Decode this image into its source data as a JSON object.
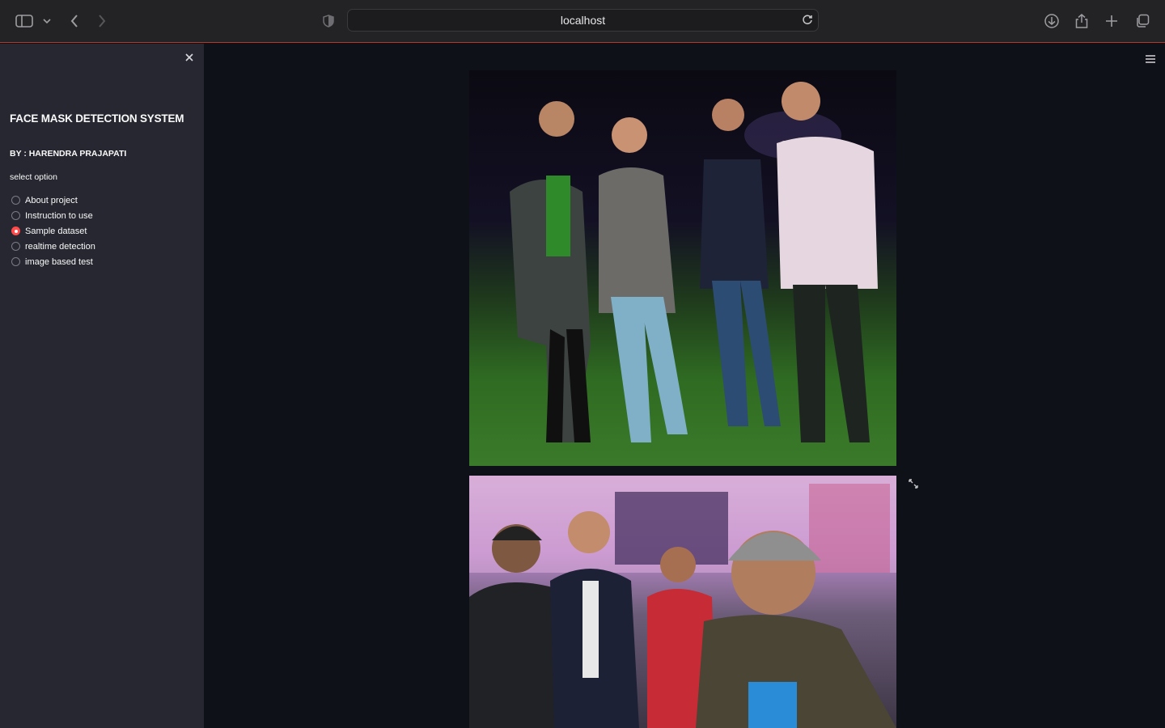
{
  "browser": {
    "url": "localhost",
    "icons": [
      "sidebar-toggle-icon",
      "chevron-down-icon",
      "back-icon",
      "forward-icon",
      "shield-icon",
      "reload-icon",
      "download-icon",
      "share-icon",
      "new-tab-icon",
      "tabs-overview-icon"
    ]
  },
  "sidebar": {
    "title": "FACE MASK DETECTION SYSTEM",
    "byline": "BY : HARENDRA PRAJAPATI",
    "select_label": "select option",
    "options": [
      {
        "label": "About project",
        "selected": false
      },
      {
        "label": "Instruction to use",
        "selected": false
      },
      {
        "label": "Sample dataset",
        "selected": true
      },
      {
        "label": "realtime detection",
        "selected": false
      },
      {
        "label": "image based test",
        "selected": false
      }
    ],
    "accent": "#ff4b4b"
  },
  "main": {
    "images": [
      {
        "name": "sample-photo-1"
      },
      {
        "name": "sample-photo-2"
      }
    ]
  },
  "colors": {
    "app_bg": "#0e1117",
    "sidebar_bg": "#262730",
    "chrome_bg": "#232326"
  }
}
